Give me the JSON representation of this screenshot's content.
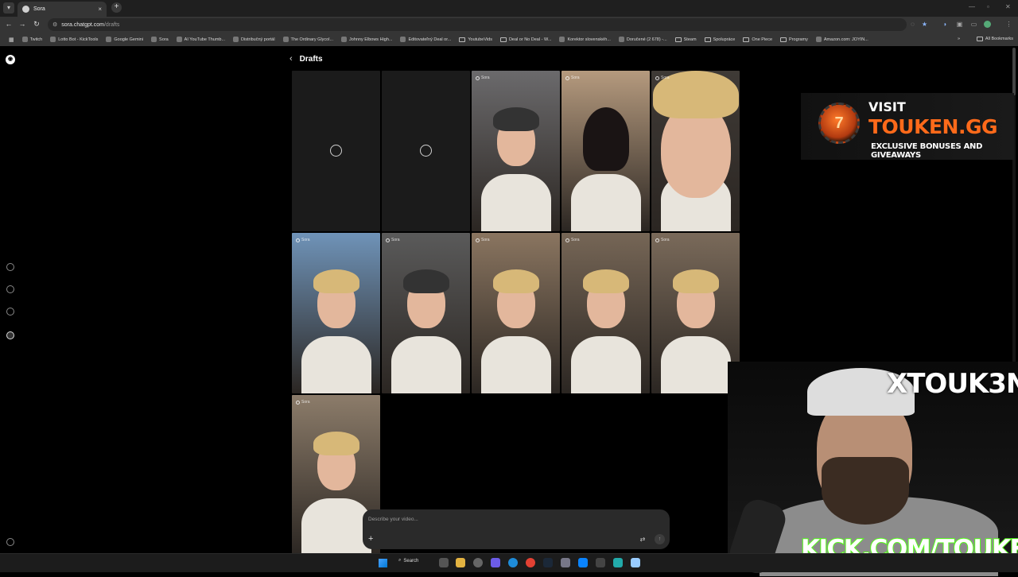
{
  "browser": {
    "tab_title": "Sora",
    "tab_close": "×",
    "new_tab": "+",
    "url_host": "sora.chatgpt.com",
    "url_path": "/drafts",
    "window_controls": [
      "—",
      "▫",
      "✕"
    ]
  },
  "bookmarks": {
    "items": [
      {
        "label": "Twitch",
        "type": "site"
      },
      {
        "label": "Lotto Bot - KickTools",
        "type": "site"
      },
      {
        "label": "Google Gemini",
        "type": "site"
      },
      {
        "label": "Sora",
        "type": "site"
      },
      {
        "label": "AI YouTube Thumb...",
        "type": "site"
      },
      {
        "label": "Distribučný portál",
        "type": "site"
      },
      {
        "label": "The Ordinary Glycol...",
        "type": "site"
      },
      {
        "label": "Johnny Elbows High...",
        "type": "site"
      },
      {
        "label": "Editovateľný Deal or...",
        "type": "site"
      },
      {
        "label": "YoutubeVids",
        "type": "folder"
      },
      {
        "label": "Deal or No Deal - W...",
        "type": "folder"
      },
      {
        "label": "Korektor slovenskéh...",
        "type": "site"
      },
      {
        "label": "Doručené (2 678) -...",
        "type": "site"
      },
      {
        "label": "Steam",
        "type": "folder"
      },
      {
        "label": "Spolupráce",
        "type": "folder"
      },
      {
        "label": "One Piece",
        "type": "folder"
      },
      {
        "label": "Programy",
        "type": "folder"
      },
      {
        "label": "Amazon.com: JOYIN...",
        "type": "site"
      }
    ],
    "more": "»",
    "all_bookmarks": "All Bookmarks"
  },
  "page": {
    "title": "Drafts",
    "back_icon": "‹",
    "watermark": "Sora"
  },
  "tiles": [
    {
      "kind": "loading"
    },
    {
      "kind": "loading"
    },
    {
      "kind": "image",
      "bg": "#6b6a6c",
      "scene": "street-shield"
    },
    {
      "kind": "image",
      "bg": "#b59a7e",
      "scene": "woman"
    },
    {
      "kind": "image",
      "bg": "#3f3a36",
      "scene": "closeup"
    },
    {
      "kind": "image",
      "bg": "#6f93b8",
      "scene": "rifle"
    },
    {
      "kind": "image",
      "bg": "#5a5a5a",
      "scene": "car"
    },
    {
      "kind": "image",
      "bg": "#8a7560",
      "scene": "talking"
    },
    {
      "kind": "image",
      "bg": "#766656",
      "scene": "pointing"
    },
    {
      "kind": "image",
      "bg": "#7a6a5a",
      "scene": "shouting"
    },
    {
      "kind": "image",
      "bg": "#8c7c6a",
      "scene": "talking2"
    }
  ],
  "composer": {
    "placeholder": "Describe your video...",
    "plus": "+",
    "settings_icon": "⇄",
    "send_icon": "↑"
  },
  "overlay": {
    "ad_visit": "VISIT",
    "ad_brand": "TOUKEN.GG",
    "ad_tagline": "EXCLUSIVE BONUSES AND GIVEAWAYS",
    "ad_coin": "7",
    "x_handle": "TOUK3N",
    "kick_handle": "KICK.COM/TOUKEN"
  },
  "taskbar": {
    "search_label": "Search"
  }
}
